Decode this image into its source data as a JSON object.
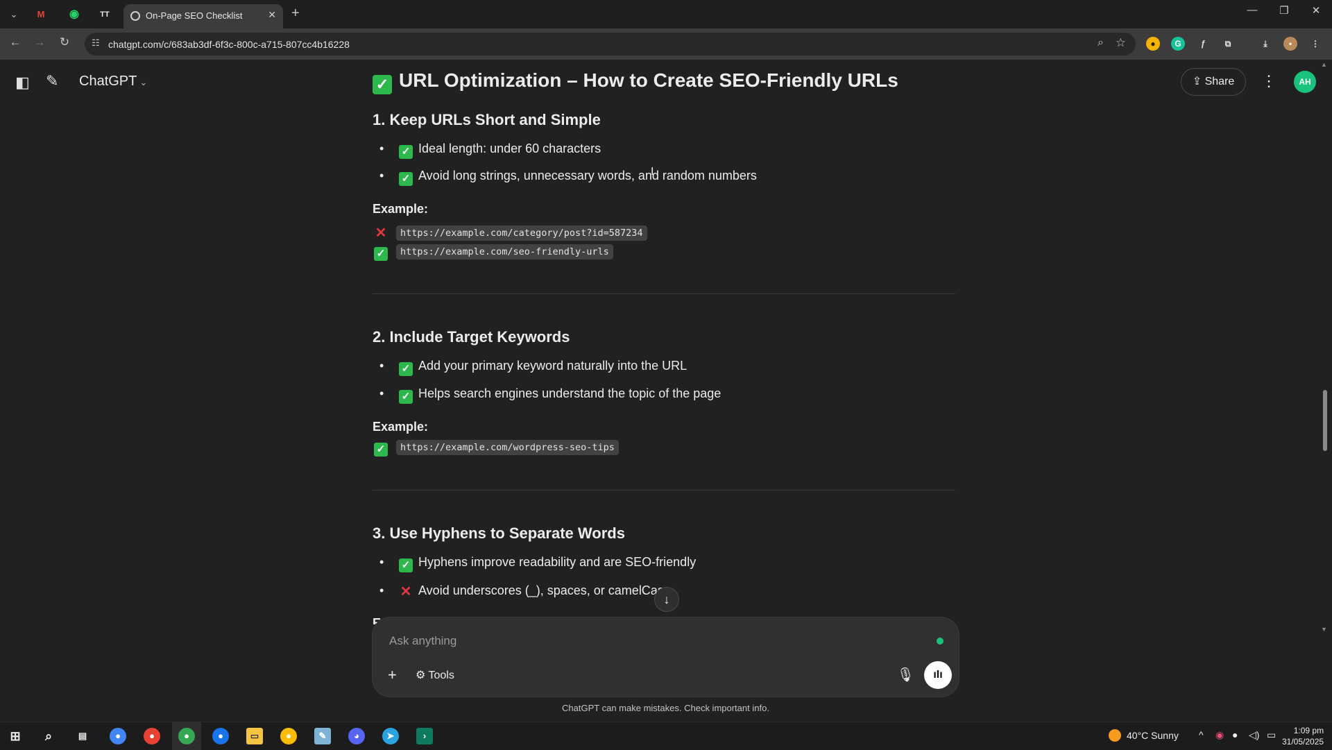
{
  "browser": {
    "active_tab_title": "On-Page SEO Checklist",
    "url": "chatgpt.com/c/683ab3df-6f3c-800c-a715-807cc4b16228",
    "pinned_tabs": [
      "gmail-icon",
      "whatsapp-icon",
      "tt-icon"
    ],
    "pinned_labels": [
      "M",
      "◉",
      "TT"
    ]
  },
  "app": {
    "name": "ChatGPT",
    "share_label": "Share",
    "avatar_initials": "AH"
  },
  "content": {
    "heading": "URL Optimization – How to Create SEO-Friendly URLs",
    "sections": [
      {
        "title": "1. Keep URLs Short and Simple",
        "bullets": [
          {
            "mark": "check",
            "text": "Ideal length: under 60 characters"
          },
          {
            "mark": "check",
            "text": "Avoid long strings, unnecessary words, and random numbers"
          }
        ],
        "example_label": "Example:",
        "examples": [
          {
            "mark": "cross",
            "code": "https://example.com/category/post?id=587234"
          },
          {
            "mark": "check",
            "code": "https://example.com/seo-friendly-urls"
          }
        ]
      },
      {
        "title": "2. Include Target Keywords",
        "bullets": [
          {
            "mark": "check",
            "text": "Add your primary keyword naturally into the URL"
          },
          {
            "mark": "check",
            "text": "Helps search engines understand the topic of the page"
          }
        ],
        "example_label": "Example:",
        "examples": [
          {
            "mark": "check",
            "code": "https://example.com/wordpress-seo-tips"
          }
        ]
      },
      {
        "title": "3. Use Hyphens to Separate Words",
        "bullets": [
          {
            "mark": "check",
            "text": "Hyphens improve readability and are SEO-friendly"
          },
          {
            "mark": "cross",
            "text": "Avoid underscores (_), spaces, or camelCase"
          }
        ],
        "truncated_label": "E"
      }
    ]
  },
  "composer": {
    "placeholder": "Ask anything",
    "tools_label": "Tools"
  },
  "disclaimer": "ChatGPT can make mistakes. Check important info.",
  "taskbar": {
    "weather_temp": "40°C",
    "weather_text": "Sunny",
    "time": "1:09 pm",
    "date": "31/05/2025"
  },
  "colors": {
    "check_green": "#2db84d",
    "cross_red": "#e0393e",
    "accent_green": "#19c37d",
    "background": "#212121"
  }
}
